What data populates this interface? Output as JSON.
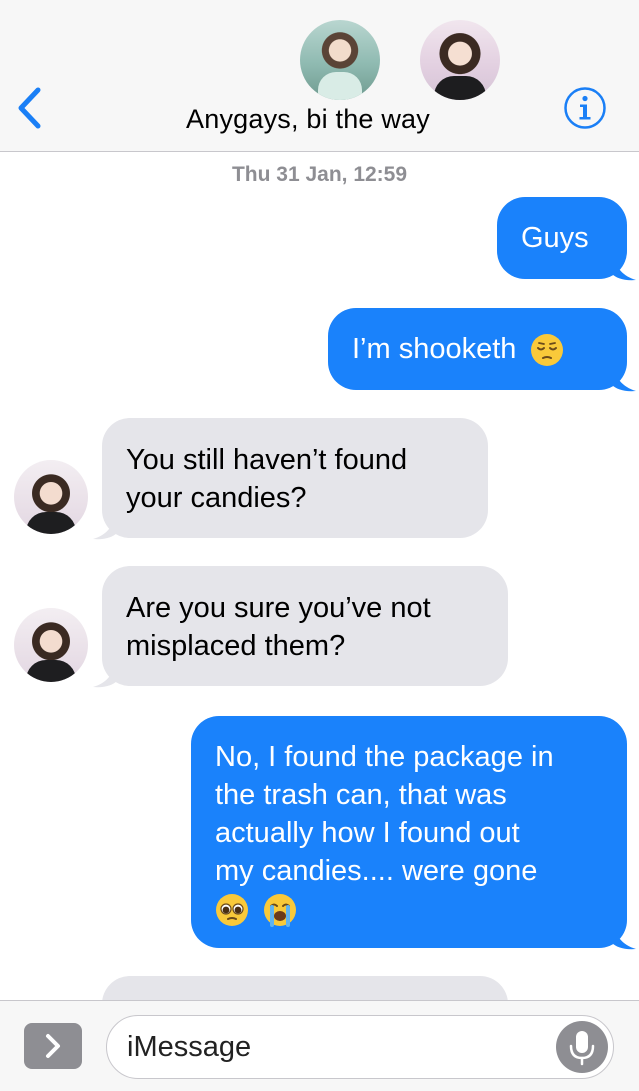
{
  "header": {
    "title": "Anygays, bi the way",
    "back_icon": "chevron-left-icon",
    "info_icon": "info-icon",
    "accent_color": "#1a7ff6"
  },
  "thread": {
    "timestamp": "Thu 31 Jan, 12:59",
    "messages": [
      {
        "direction": "outgoing",
        "text": "Guys"
      },
      {
        "direction": "outgoing",
        "text": "I’m shooketh",
        "emoji": [
          "pensive-face-emoji"
        ]
      },
      {
        "direction": "incoming",
        "lines": [
          "You still haven’t found",
          "your candies?"
        ]
      },
      {
        "direction": "incoming",
        "lines": [
          "Are you sure you’ve not",
          "misplaced them?"
        ]
      },
      {
        "direction": "outgoing",
        "lines": [
          "No, I found the package in",
          "the trash can, that was",
          "actually how I found out",
          "my candies.... were gone"
        ],
        "emoji": [
          "pleading-face-emoji",
          "loudly-crying-face-emoji"
        ]
      },
      {
        "direction": "incoming",
        "text": ""
      }
    ],
    "outgoing_color": "#1a82fb",
    "incoming_color": "#e5e5ea"
  },
  "composer": {
    "placeholder": "iMessage",
    "apps_icon": "chevron-right-icon",
    "mic_icon": "microphone-icon"
  }
}
